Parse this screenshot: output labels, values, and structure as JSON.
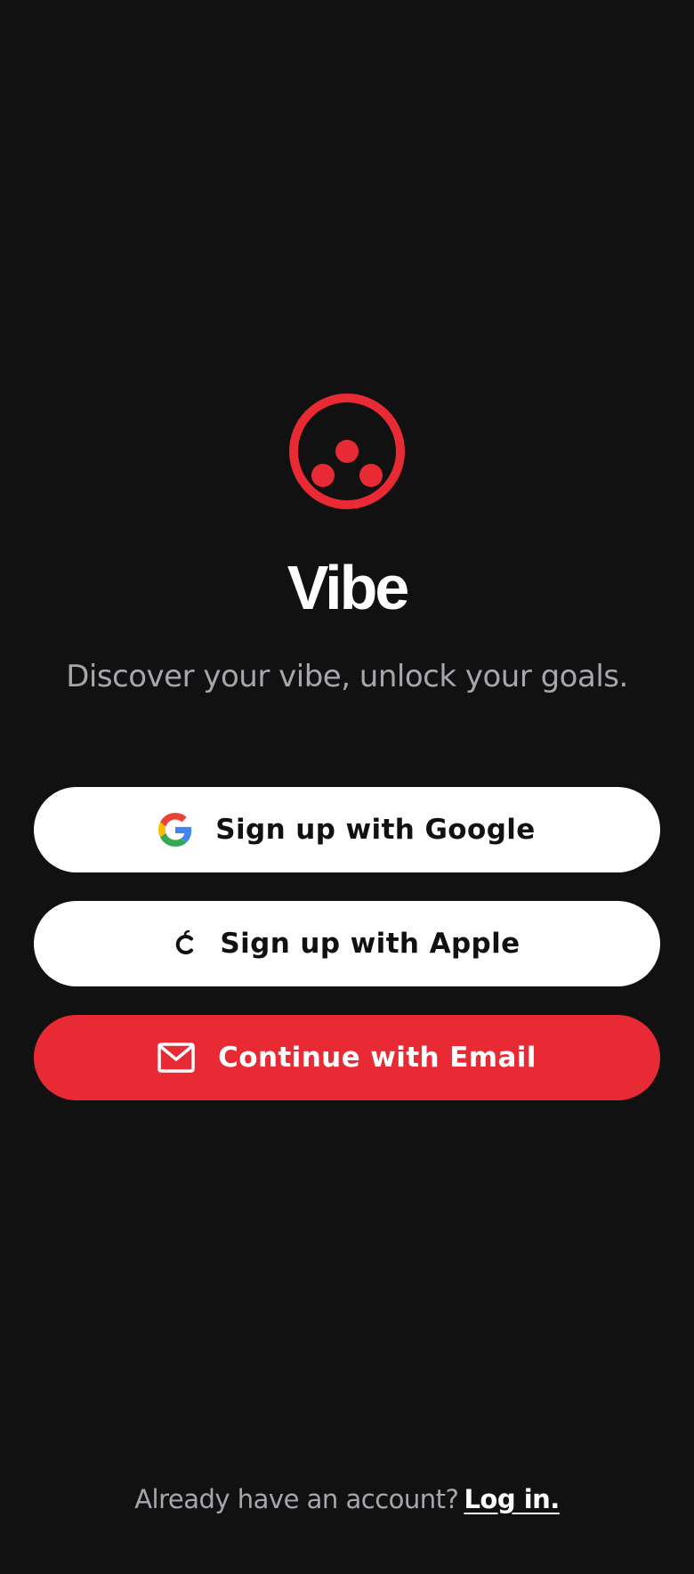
{
  "app": {
    "title": "Vibe",
    "tagline": "Discover your vibe, unlock your goals.",
    "logo_icon": "vibe-logo-icon",
    "brand_color": "#e82a35",
    "background_color": "#111111"
  },
  "buttons": {
    "google": {
      "label": "Sign up with Google",
      "icon": "google-icon"
    },
    "apple": {
      "label": "Sign up with Apple",
      "icon": "apple-icon"
    },
    "email": {
      "label": "Continue with Email",
      "icon": "mail-icon"
    }
  },
  "footer": {
    "prompt": "Already have an account?",
    "login_label": "Log in."
  }
}
